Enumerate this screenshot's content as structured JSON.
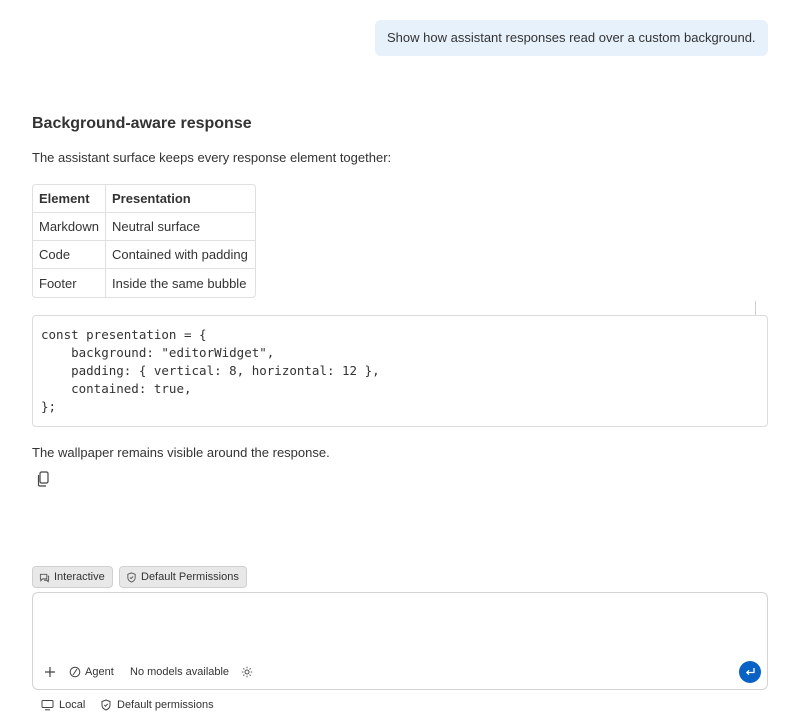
{
  "user_message": "Show how assistant responses read over a custom background.",
  "response": {
    "heading": "Background-aware response",
    "intro": "The assistant surface keeps every response element together:",
    "table": {
      "headers": [
        "Element",
        "Presentation"
      ],
      "rows": [
        [
          "Markdown",
          "Neutral surface"
        ],
        [
          "Code",
          "Contained with padding"
        ],
        [
          "Footer",
          "Inside the same bubble"
        ]
      ]
    },
    "code_lines": [
      "const presentation = {",
      "    background: \"editorWidget\",",
      "    padding: { vertical: 8, horizontal: 12 },",
      "    contained: true,",
      "};"
    ],
    "footer": "The wallpaper remains visible around the response.",
    "copy_icon": "copy-icon"
  },
  "chips": {
    "interactive": "Interactive",
    "permissions": "Default Permissions"
  },
  "input": {
    "placeholder": "",
    "agent_label": "Agent",
    "models_label": "No models available"
  },
  "status_bar": {
    "local_label": "Local",
    "permissions_label": "Default permissions"
  },
  "colors": {
    "user_bubble": "#e6f1fc",
    "send_button": "#0a61c5",
    "chip_bg": "#e8e8e8"
  }
}
